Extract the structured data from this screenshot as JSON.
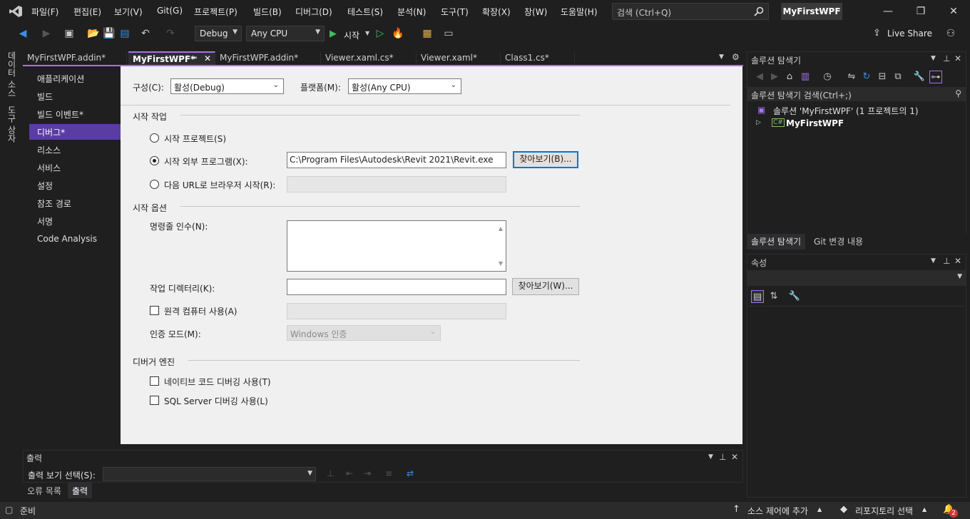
{
  "menu": [
    "파일(F)",
    "편집(E)",
    "보기(V)",
    "Git(G)",
    "프로젝트(P)",
    "빌드(B)",
    "디버그(D)",
    "테스트(S)",
    "분석(N)",
    "도구(T)",
    "확장(X)",
    "창(W)",
    "도움말(H)"
  ],
  "search": {
    "placeholder": "검색 (Ctrl+Q)"
  },
  "project_badge": "MyFirstWPF",
  "toolbar": {
    "config": "Debug",
    "platform": "Any CPU",
    "start": "시작",
    "live_share": "Live Share"
  },
  "side_tabs": [
    "데이터 소스",
    "도구 상자"
  ],
  "doc_tabs": [
    {
      "label": "MyFirstWPF.addin*"
    },
    {
      "label": "MyFirstWPF*"
    },
    {
      "label": "MyFirstWPF.addin*"
    },
    {
      "label": "Viewer.xaml.cs*"
    },
    {
      "label": "Viewer.xaml*"
    },
    {
      "label": "Class1.cs*"
    }
  ],
  "page_nav": [
    "애플리케이션",
    "빌드",
    "빌드 이벤트*",
    "디버그*",
    "리소스",
    "서비스",
    "설정",
    "참조 경로",
    "서명",
    "Code Analysis"
  ],
  "content": {
    "config_label": "구성(C):",
    "config_value": "활성(Debug)",
    "platform_label": "플랫폼(M):",
    "platform_value": "활성(Any CPU)",
    "start_action_title": "시작 작업",
    "radio_start_project": "시작 프로젝트(S)",
    "radio_external": "시작 외부 프로그램(X):",
    "external_path": "C:\\Program Files\\Autodesk\\Revit 2021\\Revit.exe",
    "browse1": "찾아보기(B)...",
    "radio_url": "다음 URL로 브라우저 시작(R):",
    "start_options_title": "시작 옵션",
    "cmd_args_label": "명령줄 인수(N):",
    "workdir_label": "작업 디렉터리(K):",
    "browse2": "찾아보기(W)...",
    "remote_label": "원격 컴퓨터 사용(A)",
    "auth_label": "인증 모드(M):",
    "auth_value": "Windows 인증",
    "debugger_engine_title": "디버거 엔진",
    "native_label": "네이티브 코드 디버깅 사용(T)",
    "sql_label": "SQL Server 디버깅 사용(L)"
  },
  "solution_explorer": {
    "title": "솔루션 탐색기",
    "search": "솔루션 탐색기 검색(Ctrl+;)",
    "solution": "솔루션 'MyFirstWPF' (1 프로젝트의 1)",
    "project": "MyFirstWPF",
    "tabs": [
      "솔루션 탐색기",
      "Git 변경 내용"
    ]
  },
  "properties": {
    "title": "속성"
  },
  "output": {
    "title": "출력",
    "show_label": "출력 보기 선택(S):",
    "tabs": [
      "오류 목록",
      "출력"
    ]
  },
  "status": {
    "ready": "준비",
    "source_control": "소스 제어에 추가",
    "repo": "리포지토리 선택",
    "notifications": "2"
  }
}
